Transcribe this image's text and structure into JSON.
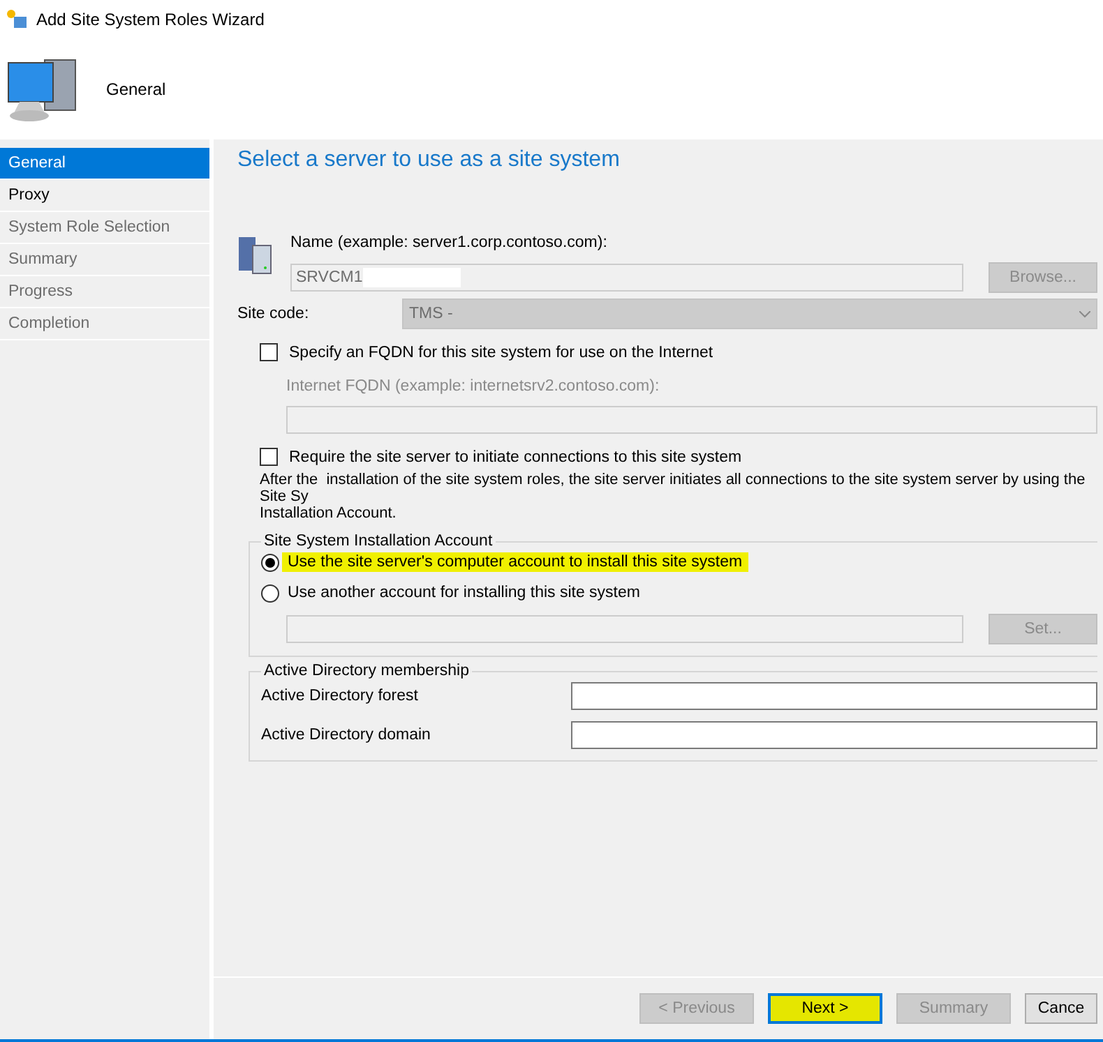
{
  "window": {
    "title": "Add Site System Roles Wizard"
  },
  "header": {
    "title": "General"
  },
  "steps": [
    {
      "label": "General",
      "selected": true,
      "disabled": false
    },
    {
      "label": "Proxy",
      "selected": false,
      "disabled": false
    },
    {
      "label": "System Role Selection",
      "selected": false,
      "disabled": true
    },
    {
      "label": "Summary",
      "selected": false,
      "disabled": true
    },
    {
      "label": "Progress",
      "selected": false,
      "disabled": true
    },
    {
      "label": "Completion",
      "selected": false,
      "disabled": true
    }
  ],
  "page": {
    "heading": "Select a server to use as a site system",
    "name_label": "Name (example: server1.corp.contoso.com):",
    "name_value": "SRVCM1",
    "browse": "Browse...",
    "site_code_label": "Site code:",
    "site_code_value": "TMS -",
    "fqdn_check": {
      "label": "Specify an FQDN for this site system for use on the Internet",
      "checked": false
    },
    "fqdn_label": "Internet FQDN (example: internetsrv2.contoso.com):",
    "require_check": {
      "label": "Require the site server to initiate connections to this site system",
      "checked": false
    },
    "note": "After the  installation of the site system roles, the site server initiates all connections to the site system server by using the Site Sy",
    "note_2": "Installation Account.",
    "account_group": "Site System Installation Account",
    "account_options": [
      {
        "label": "Use the site server's computer account to install this site system",
        "selected": true,
        "highlighted": true
      },
      {
        "label": "Use another account for installing this site system",
        "selected": false,
        "highlighted": false
      }
    ],
    "set": "Set...",
    "ad_group": "Active Directory membership",
    "ad_fields": [
      {
        "label": "Active Directory forest"
      },
      {
        "label": "Active Directory domain"
      }
    ]
  },
  "buttons": [
    {
      "label": "< Previous",
      "disabled": true,
      "highlighted": false
    },
    {
      "label": "Next >",
      "disabled": false,
      "highlighted": true
    },
    {
      "label": "Summary",
      "disabled": true,
      "highlighted": false
    },
    {
      "label": "Cance",
      "disabled": false,
      "highlighted": false
    }
  ]
}
